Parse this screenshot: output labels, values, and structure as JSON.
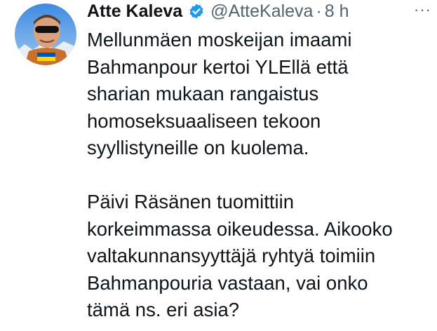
{
  "tweet": {
    "author": {
      "name": "Atte Kaleva",
      "handle": "@AtteKaleva",
      "separator": "·",
      "time": "8 h",
      "verified": true,
      "avatar": "profile-photo"
    },
    "more_icon": "more-icon",
    "paragraphs": [
      {
        "lines": [
          "Mellunmäen moskeijan imaami",
          "Bahmanpour kertoi YLEllä että",
          "sharian mukaan rangaistus",
          "homoseksuaaliseen tekoon",
          "syyllistyneille on kuolema."
        ]
      },
      {
        "lines": [
          "Päivi Räsänen tuomittiin",
          "korkeimmassa oikeudessa. Aikooko",
          "valtakunnansyyttäjä ryhtyä toimiin",
          "Bahmanpouria vastaan, vai onko",
          "tämä ns. eri asia?"
        ]
      }
    ]
  },
  "colors": {
    "text": "#0f1419",
    "secondary": "#536471",
    "verified_badge": "#1d9bf0"
  }
}
